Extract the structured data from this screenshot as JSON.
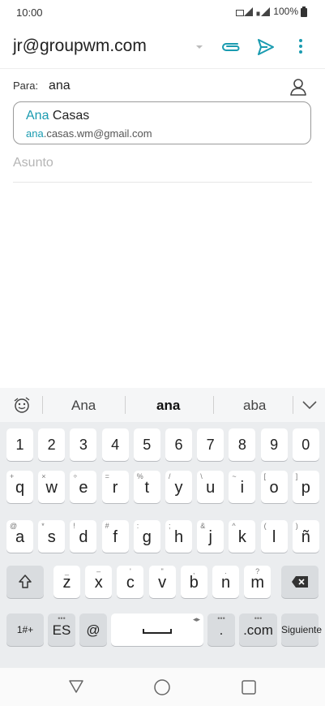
{
  "status": {
    "time": "10:00",
    "battery": "100%"
  },
  "header": {
    "account": "jr@groupwm.com"
  },
  "compose": {
    "to_label": "Para:",
    "to_value": "ana",
    "suggestion": {
      "name_match": "Ana",
      "name_rest": " Casas",
      "email_match": "ana",
      "email_rest": ".casas.wm@gmail.com"
    },
    "subject_placeholder": "Asunto"
  },
  "keyboard": {
    "suggestions": [
      "Ana",
      "ana",
      "aba"
    ],
    "row_numbers": [
      "1",
      "2",
      "3",
      "4",
      "5",
      "6",
      "7",
      "8",
      "9",
      "0"
    ],
    "row1": [
      {
        "k": "q",
        "s": "+"
      },
      {
        "k": "w",
        "s": "×"
      },
      {
        "k": "e",
        "s": "÷"
      },
      {
        "k": "r",
        "s": "="
      },
      {
        "k": "t",
        "s": "%"
      },
      {
        "k": "y",
        "s": "/"
      },
      {
        "k": "u",
        "s": "\\"
      },
      {
        "k": "i",
        "s": "~"
      },
      {
        "k": "o",
        "s": "["
      },
      {
        "k": "p",
        "s": "]"
      }
    ],
    "row2": [
      {
        "k": "a",
        "s": "@"
      },
      {
        "k": "s",
        "s": "*"
      },
      {
        "k": "d",
        "s": "!"
      },
      {
        "k": "f",
        "s": "#"
      },
      {
        "k": "g",
        "s": ":"
      },
      {
        "k": "h",
        "s": ";"
      },
      {
        "k": "j",
        "s": "&"
      },
      {
        "k": "k",
        "s": "^"
      },
      {
        "k": "l",
        "s": "("
      },
      {
        "k": "ñ",
        "s": ")"
      }
    ],
    "row3": [
      {
        "k": "z",
        "s": "_"
      },
      {
        "k": "x",
        "s": "–"
      },
      {
        "k": "c",
        "s": "'"
      },
      {
        "k": "v",
        "s": "\""
      },
      {
        "k": "b",
        "s": ","
      },
      {
        "k": "n",
        "s": "."
      },
      {
        "k": "m",
        "s": "?"
      }
    ],
    "bottom": {
      "symbols": "1#+",
      "lang": "ES",
      "at": "@",
      "period": ".",
      "com": ".com",
      "action": "Siguiente"
    }
  }
}
